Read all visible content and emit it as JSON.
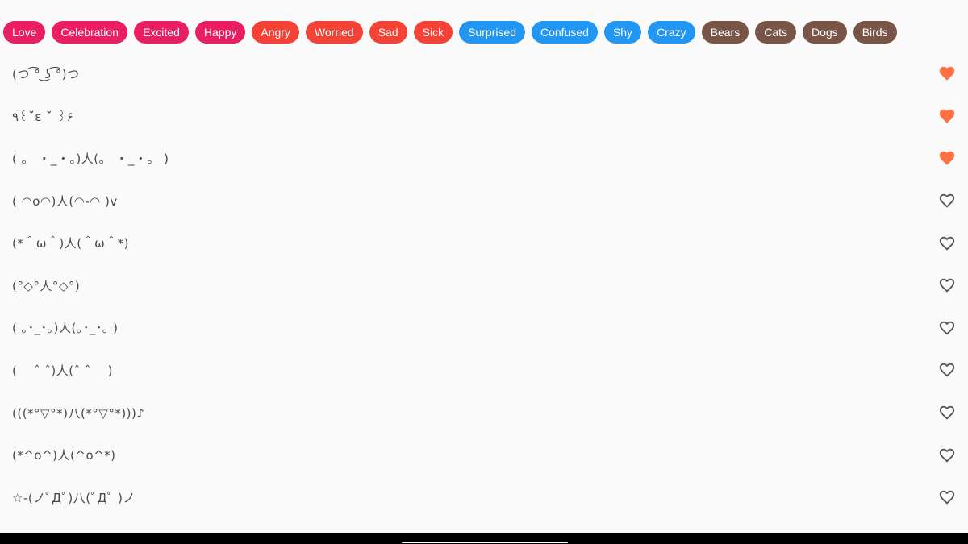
{
  "categories": [
    {
      "label": "Love",
      "color": "#e91e63"
    },
    {
      "label": "Celebration",
      "color": "#e91e63"
    },
    {
      "label": "Excited",
      "color": "#e91e63"
    },
    {
      "label": "Happy",
      "color": "#e91e63"
    },
    {
      "label": "Angry",
      "color": "#f44336"
    },
    {
      "label": "Worried",
      "color": "#f44336"
    },
    {
      "label": "Sad",
      "color": "#f44336"
    },
    {
      "label": "Sick",
      "color": "#f44336"
    },
    {
      "label": "Surprised",
      "color": "#2196f3"
    },
    {
      "label": "Confused",
      "color": "#2196f3"
    },
    {
      "label": "Shy",
      "color": "#2196f3"
    },
    {
      "label": "Crazy",
      "color": "#2196f3"
    },
    {
      "label": "Bears",
      "color": "#795548"
    },
    {
      "label": "Cats",
      "color": "#795548"
    },
    {
      "label": "Dogs",
      "color": "#795548"
    },
    {
      "label": "Birds",
      "color": "#795548"
    }
  ],
  "emoticons": [
    {
      "text": "(つ ͡° ͜ʖ ͡°)つ",
      "favorite": true
    },
    {
      "text": "٩꒰ˊ̆ε ˋ̆ ꒱۶",
      "favorite": true
    },
    {
      "text": "( 。 ・_・。)人(。 ・_・。 )",
      "favorite": true
    },
    {
      "text": "( ◠o◠)人(◠-◠ )v",
      "favorite": false
    },
    {
      "text": "(*＾ω＾)人(＾ω＾*)",
      "favorite": false
    },
    {
      "text": "(°◇°人°◇°)",
      "favorite": false
    },
    {
      "text": "( ｡･_･｡)人(｡･_･｡ )",
      "favorite": false
    },
    {
      "text": "( 　ˆ ˆ)人(ˆ ˆ 　)",
      "favorite": false
    },
    {
      "text": "(((*°▽°*)八(*°▽°*)))♪",
      "favorite": false
    },
    {
      "text": "(*^o^)人(^o^*)",
      "favorite": false
    },
    {
      "text": "☆-(ノﾟДﾟ)八(ﾟДﾟ )ノ",
      "favorite": false
    }
  ],
  "icons": {
    "favorite_filled": "heart-filled-icon",
    "favorite_outline": "heart-outline-icon"
  },
  "colors": {
    "heart_filled": "#ff7043",
    "heart_outline": "#555555",
    "background": "#fafafa"
  }
}
